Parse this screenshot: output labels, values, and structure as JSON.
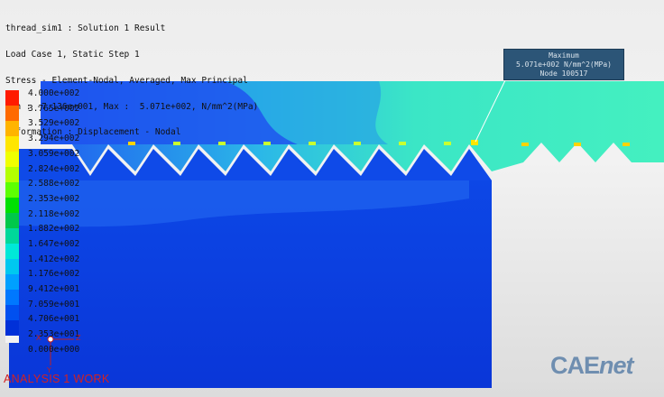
{
  "header": {
    "lines": [
      "thread_sim1 : Solution 1 Result",
      "Load Case 1, Static Step 1",
      "Stress - Element-Nodal, Averaged, Max Principal",
      "Min : -7.136e+001, Max :  5.071e+002, N/mm^2(MPa)",
      "Deformation : Displacement - Nodal"
    ]
  },
  "legend": {
    "labels": [
      "4.000e+002",
      "3.765e+002",
      "3.529e+002",
      "3.294e+002",
      "3.059e+002",
      "2.824e+002",
      "2.588e+002",
      "2.353e+002",
      "2.118e+002",
      "1.882e+002",
      "1.647e+002",
      "1.412e+002",
      "1.176e+002",
      "9.412e+001",
      "7.059e+001",
      "4.706e+001",
      "2.353e+001",
      "0.000e+000"
    ],
    "colors": [
      "#ff1a00",
      "#ff6a00",
      "#ffb400",
      "#ffe600",
      "#f0ff00",
      "#b4ff00",
      "#5dff00",
      "#00e000",
      "#00c84a",
      "#00d89a",
      "#00e8d8",
      "#00c8f0",
      "#00a0ff",
      "#0078ff",
      "#0050f0",
      "#0030d8",
      "#f2f2f2"
    ]
  },
  "max_annotation": {
    "title": "Maximum",
    "value": "5.071e+002 N/mm^2(MPa)",
    "node": "Node 100517"
  },
  "footer": {
    "label": "ANALYSIS 1 WORK"
  },
  "triad": {
    "x_label": "X",
    "y_label": "Y",
    "z_label": "Z"
  },
  "brand": {
    "ca": "CAE",
    "net": "net"
  },
  "colors": {
    "bolt_fill": "#0b3ee0",
    "nut_fill": "#39e5c2",
    "high_stress_tip": "#ffd400",
    "max_box_bg": "#2c5577",
    "footer_text": "#d32121",
    "brand_text": "#6f8eb0"
  }
}
